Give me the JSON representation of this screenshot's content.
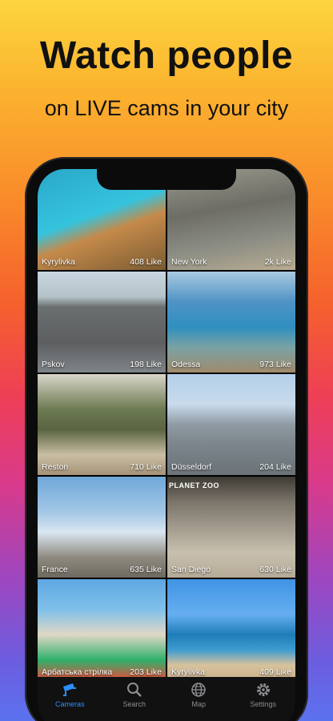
{
  "promo": {
    "headline": "Watch people",
    "subline": "on LIVE cams in your city"
  },
  "cameras": [
    {
      "name": "Kyrylivka",
      "likes": "408 Like"
    },
    {
      "name": "New York",
      "likes": "2k Like"
    },
    {
      "name": "Pskov",
      "likes": "198 Like"
    },
    {
      "name": "Odessa",
      "likes": "973 Like"
    },
    {
      "name": "Reston",
      "likes": "710 Like"
    },
    {
      "name": "Düsseldorf",
      "likes": "204 Like"
    },
    {
      "name": "France",
      "likes": "635 Like"
    },
    {
      "name": "San Diego",
      "likes": "630 Like",
      "overlay": "PLANET ZOO"
    },
    {
      "name": "Арбатська стрілка",
      "likes": "203 Like"
    },
    {
      "name": "Kyrylivka",
      "likes": "409 Like"
    }
  ],
  "tabbar": {
    "tabs": [
      {
        "label": "Cameras",
        "icon": "camera-icon",
        "active": true
      },
      {
        "label": "Search",
        "icon": "search-icon",
        "active": false
      },
      {
        "label": "Map",
        "icon": "globe-icon",
        "active": false
      },
      {
        "label": "Settings",
        "icon": "gear-icon",
        "active": false
      }
    ],
    "active_color": "#2b8fff",
    "inactive_color": "#8e8e93"
  }
}
